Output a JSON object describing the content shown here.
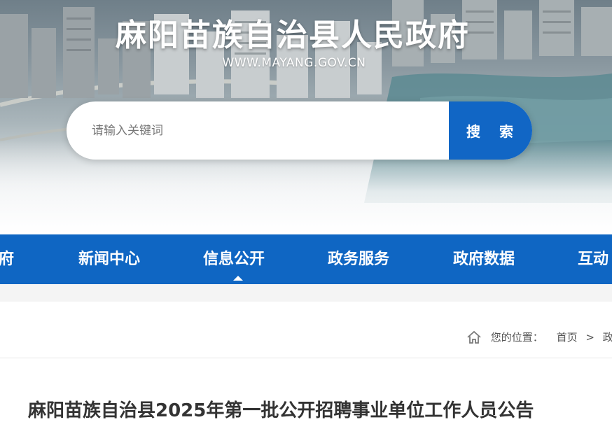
{
  "site": {
    "title": "麻阳苗族自治县人民政府",
    "url": "WWW.MAYANG.GOV.CN"
  },
  "search": {
    "placeholder": "请输入关键词",
    "value": "",
    "button_label": "搜 索"
  },
  "nav": {
    "items": [
      {
        "label": "府"
      },
      {
        "label": "新闻中心"
      },
      {
        "label": "信息公开",
        "active": true
      },
      {
        "label": "政务服务"
      },
      {
        "label": "政府数据"
      },
      {
        "label": "互动"
      }
    ]
  },
  "breadcrumb": {
    "prefix": "您的位置：",
    "items": [
      "首页",
      "政务"
    ],
    "separator": ">"
  },
  "article": {
    "title": "麻阳苗族自治县2025年第一批公开招聘事业单位工作人员公告"
  },
  "colors": {
    "primary": "#1166c5",
    "nav_bg": "#0f66c3",
    "title_text": "#333333"
  },
  "icons": {
    "breadcrumb": "home-icon",
    "nav_active": "caret-up-icon"
  }
}
